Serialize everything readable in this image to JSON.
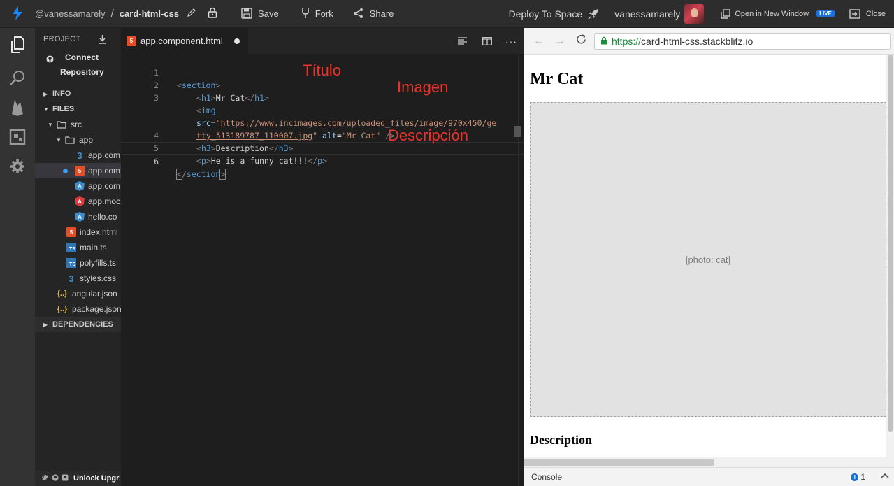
{
  "topbar": {
    "user": "@vanessamarely",
    "separator": "/",
    "project": "card-html-css",
    "save": "Save",
    "fork": "Fork",
    "share": "Share",
    "deploy": "Deploy To Space",
    "username": "vanessamarely",
    "open_new_window": "Open in New Window",
    "live": "LIVE",
    "close": "Close"
  },
  "sidebar": {
    "project_label": "PROJECT",
    "connect_line1": "Connect",
    "connect_line2": "Repository",
    "info": "INFO",
    "files": "FILES",
    "tree": [
      {
        "label": "src"
      },
      {
        "label": "app"
      },
      {
        "label": "app.com"
      },
      {
        "label": "app.com"
      },
      {
        "label": "app.com"
      },
      {
        "label": "app.moc"
      },
      {
        "label": "hello.co"
      },
      {
        "label": "index.html"
      },
      {
        "label": "main.ts"
      },
      {
        "label": "polyfills.ts"
      },
      {
        "label": "styles.css"
      },
      {
        "label": "angular.json"
      },
      {
        "label": "package.json"
      }
    ],
    "dependencies": "DEPENDENCIES",
    "bottom": "Unlock Upgr"
  },
  "editor": {
    "tab_name": "app.component.html",
    "line_numbers": [
      "1",
      "2",
      "3",
      "",
      "4",
      "5",
      "6"
    ],
    "code": {
      "section_tag": "section",
      "h1_tag": "h1",
      "h1_text": "Mr Cat",
      "img_tag": "img",
      "src_attr": "src",
      "src_value_part1": "https://www.incimages.com/uploaded_files/image/970x450/ge",
      "src_value_part2": "tty_513189787_110007.jpg",
      "alt_attr": "alt",
      "alt_value": "\"Mr Cat\"",
      "self_close": " />",
      "h3_tag": "h3",
      "h3_text": "Description",
      "p_tag": "p",
      "p_text": "He is a funny cat!!!"
    },
    "annotations": {
      "titulo": "Título",
      "imagen": "Imagen",
      "descripcion": "Descripción"
    }
  },
  "preview": {
    "url_protocol": "https://",
    "url_host": "card-html-css.stackblitz.io",
    "heading": "Mr Cat",
    "image_alt": "Mr Cat",
    "image_placeholder": "[photo: cat]",
    "subheading": "Description",
    "console_label": "Console",
    "info_count": "1"
  }
}
